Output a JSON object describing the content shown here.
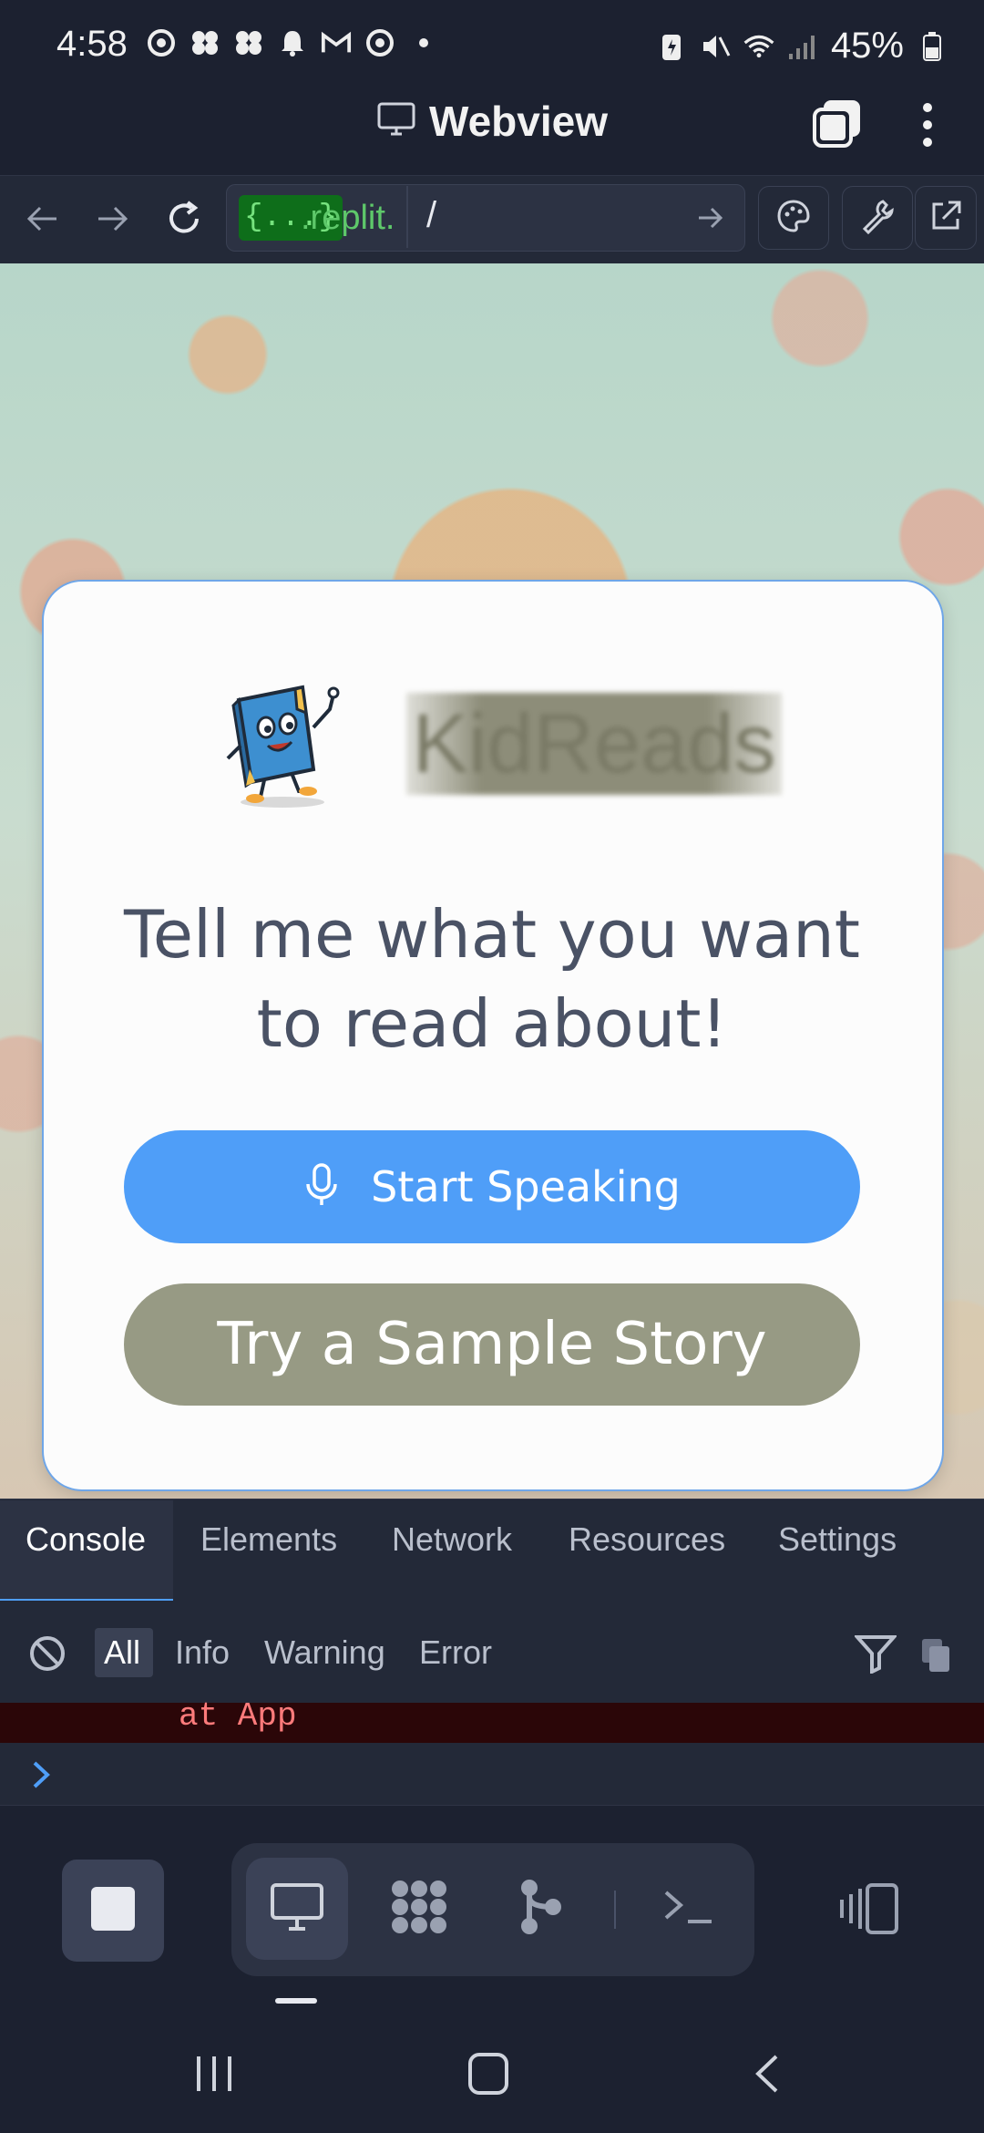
{
  "status_bar": {
    "time": "4:58",
    "battery": "45%"
  },
  "title_bar": {
    "title": "Webview"
  },
  "url_bar": {
    "badge": "{...}",
    "domain": ".replit.",
    "path": "/"
  },
  "webview": {
    "app_name": "KidReads",
    "headline": "Tell me what you want to read about!",
    "start_button": "Start Speaking",
    "sample_button": "Try a Sample Story"
  },
  "devtools": {
    "tabs": [
      "Console",
      "Elements",
      "Network",
      "Resources",
      "Settings"
    ],
    "filters": [
      "All",
      "Info",
      "Warning",
      "Error"
    ],
    "error_line": "at App"
  },
  "colors": {
    "accent": "#4f9ef8",
    "sample_button": "#979a84",
    "background": "#1c2130"
  }
}
